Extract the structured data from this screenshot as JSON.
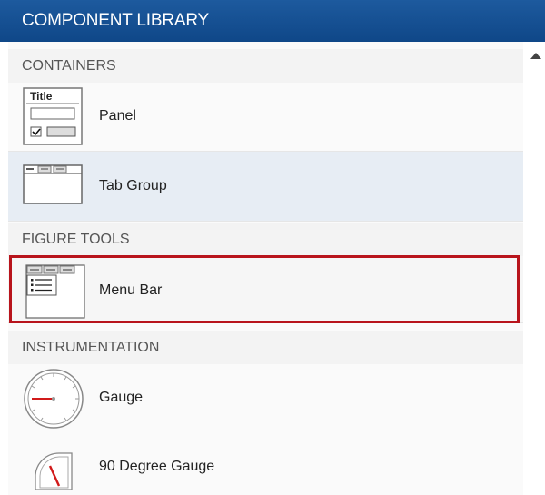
{
  "header": {
    "title": "COMPONENT LIBRARY"
  },
  "sections": {
    "containers": "CONTAINERS",
    "figure_tools": "FIGURE TOOLS",
    "instrumentation": "INSTRUMENTATION"
  },
  "items": {
    "panel": {
      "label": "Panel",
      "icon": "panel-icon",
      "icon_text": "Title"
    },
    "tab_group": {
      "label": "Tab Group",
      "icon": "tab-group-icon"
    },
    "menu_bar": {
      "label": "Menu Bar",
      "icon": "menu-bar-icon"
    },
    "gauge": {
      "label": "Gauge",
      "icon": "gauge-icon"
    },
    "degree90_gauge": {
      "label": "90 Degree Gauge",
      "icon": "ninety-degree-gauge-icon"
    }
  },
  "colors": {
    "header_bg": "#0f4788",
    "highlight_border": "#b8141c",
    "selected_bg": "#e7edf4",
    "gauge_needle": "#d11a1a"
  }
}
